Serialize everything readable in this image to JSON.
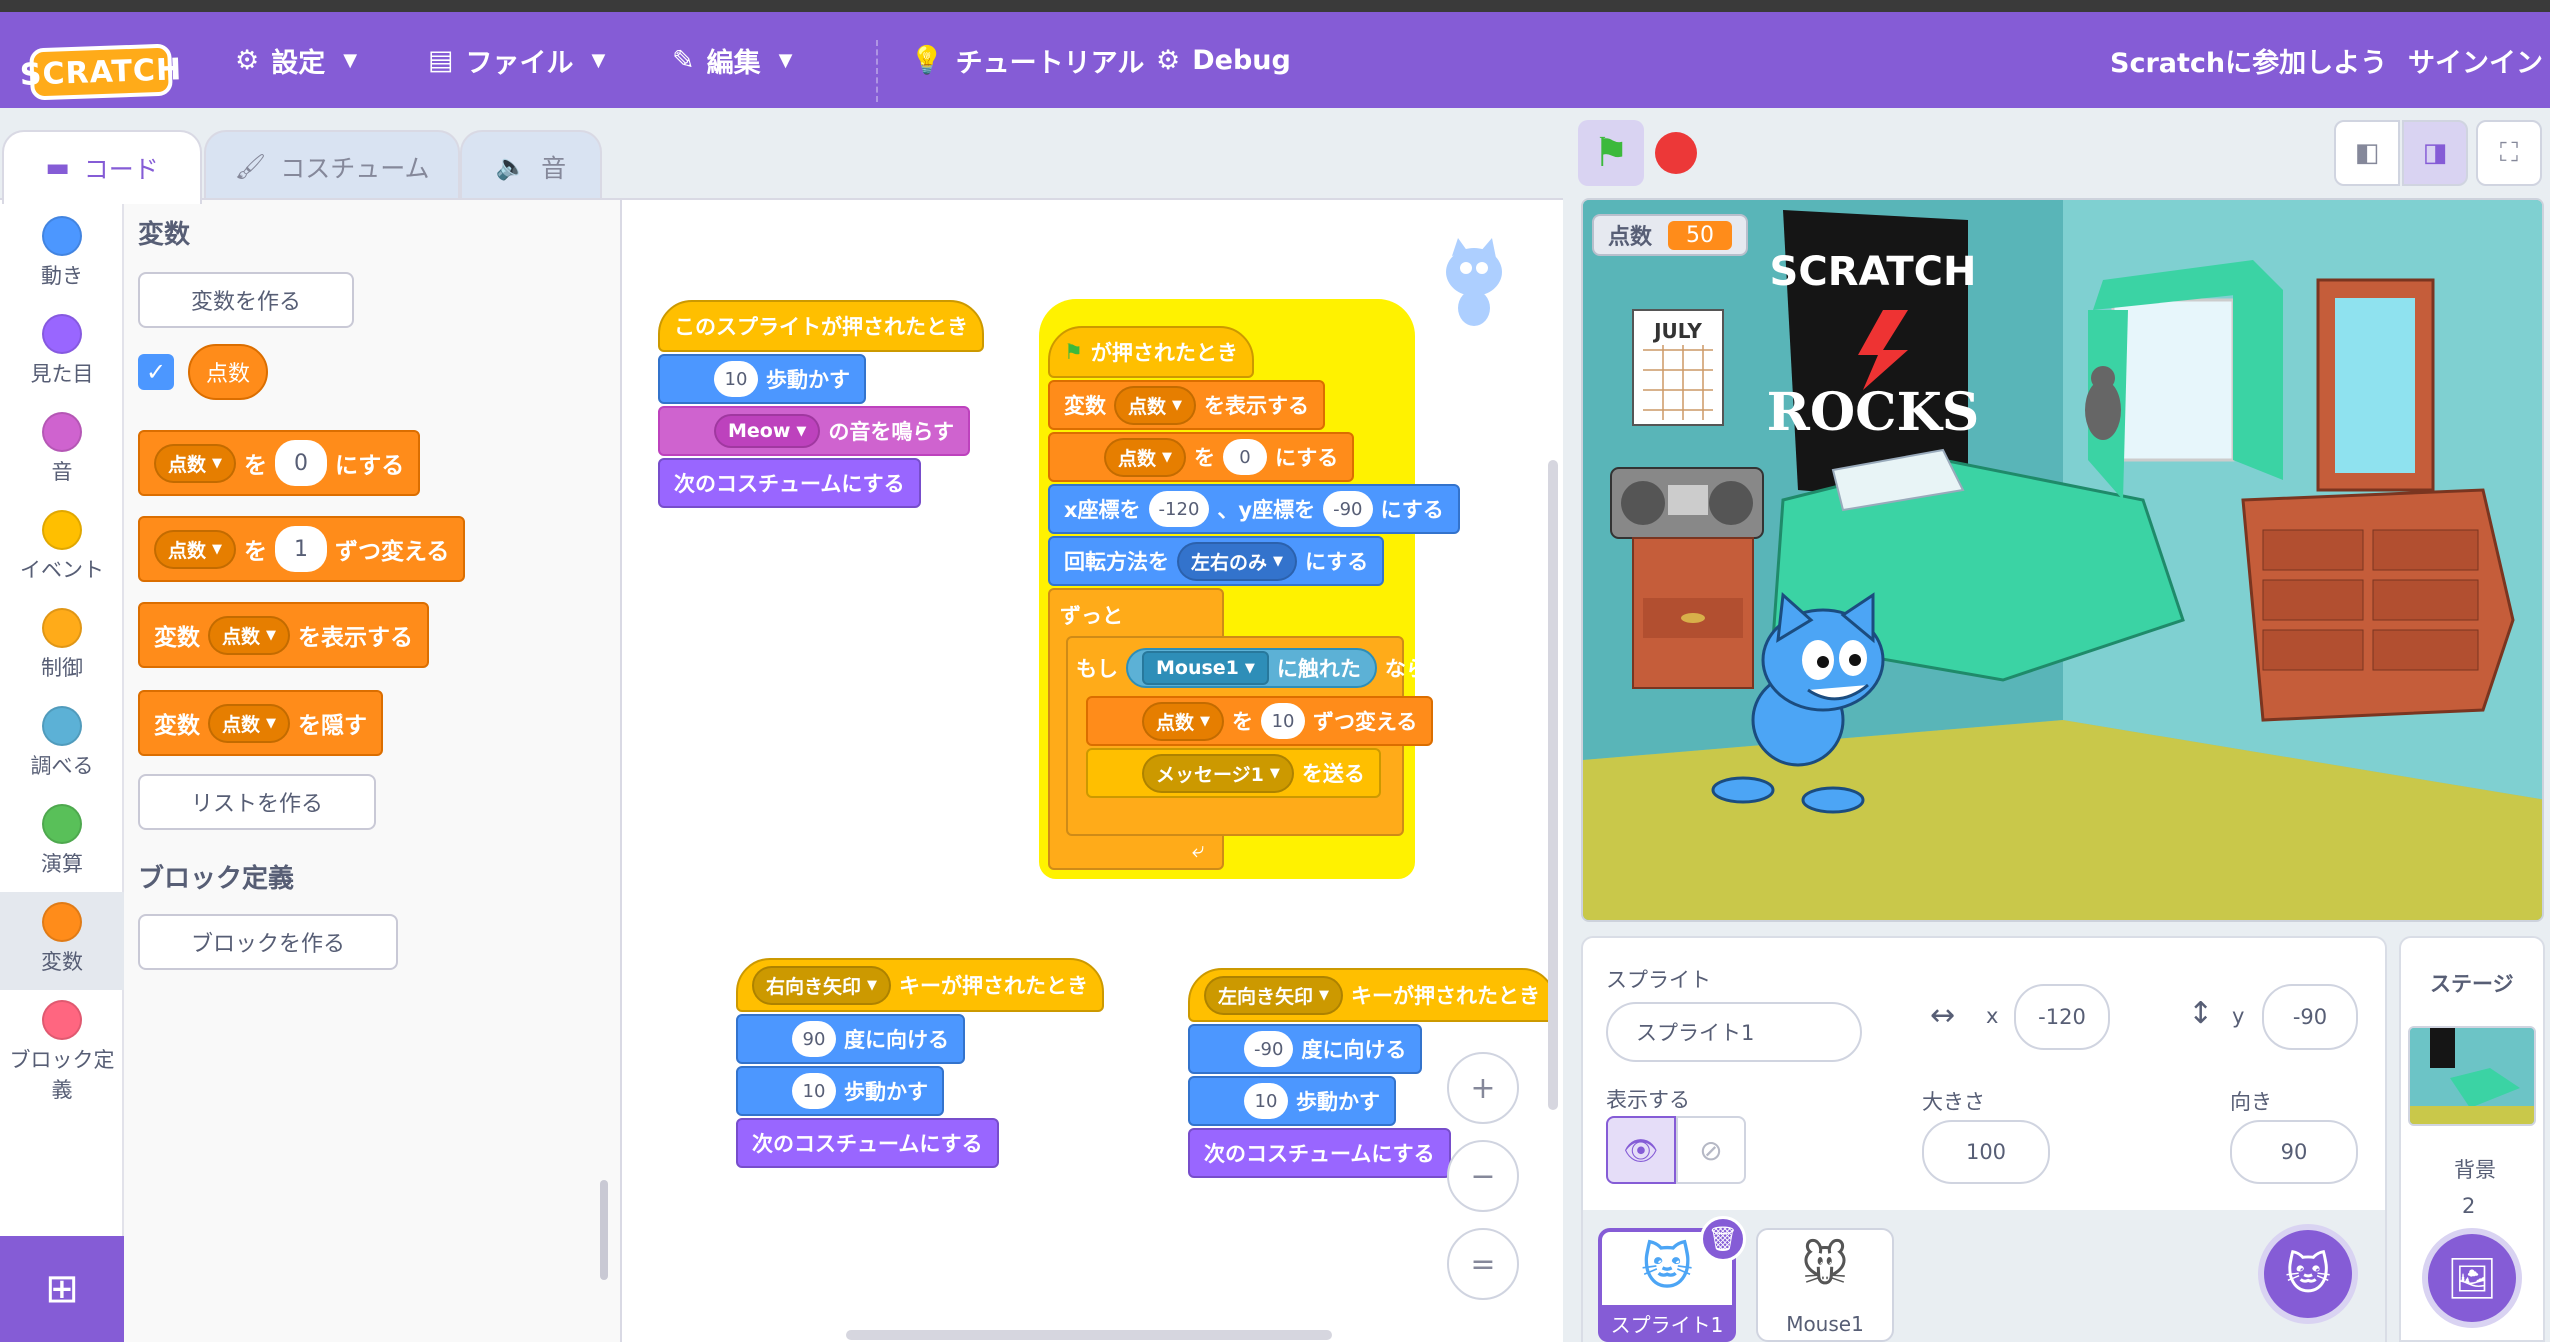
{
  "menubar": {
    "logo": "SCRATCH",
    "settings": "設定",
    "file": "ファイル",
    "edit": "編集",
    "tutorials": "チュートリアル",
    "debug": "Debug",
    "join": "Scratchに参加しよう",
    "signin": "サインイン"
  },
  "tabs": {
    "code": "コード",
    "costumes": "コスチューム",
    "sounds": "音"
  },
  "categories": [
    {
      "label": "動き",
      "color": "#4c97ff"
    },
    {
      "label": "見た目",
      "color": "#9966ff"
    },
    {
      "label": "音",
      "color": "#cf63cf"
    },
    {
      "label": "イベント",
      "color": "#ffbf00"
    },
    {
      "label": "制御",
      "color": "#ffab19"
    },
    {
      "label": "調べる",
      "color": "#5cb1d6"
    },
    {
      "label": "演算",
      "color": "#59c059"
    },
    {
      "label": "変数",
      "color": "#ff8c1a"
    },
    {
      "label": "ブロック定義",
      "color": "#ff6680"
    }
  ],
  "palette": {
    "heading": "変数",
    "make_variable": "変数を作る",
    "variable_name": "点数",
    "set_to": [
      "を",
      "0",
      "にする"
    ],
    "change_by": [
      "を",
      "1",
      "ずつ変える"
    ],
    "show_var": [
      "変数",
      "を表示する"
    ],
    "hide_var": [
      "変数",
      "を隠す"
    ],
    "make_list": "リストを作る",
    "myblocks_heading": "ブロック定義",
    "make_block": "ブロックを作る"
  },
  "scripts": {
    "s1": {
      "hat": "このスプライトが押されたとき",
      "move": "10",
      "move_lbl": "歩動かす",
      "sound": "Meow",
      "sound_lbl": "の音を鳴らす",
      "next_costume": "次のコスチュームにする"
    },
    "s2": {
      "hat": "が押されたとき",
      "show_a": "変数",
      "show_var": "点数",
      "show_b": "を表示する",
      "set_var": "点数",
      "set_a": "を",
      "set_val": "0",
      "set_b": "にする",
      "goto_a": "x座標を",
      "goto_x": "-120",
      "goto_b": "、y座標を",
      "goto_y": "-90",
      "goto_c": "にする",
      "rot_a": "回転方法を",
      "rot_val": "左右のみ",
      "rot_b": "にする",
      "forever": "ずっと",
      "if_a": "もし",
      "touch": "Mouse1",
      "touch_b": "に触れた",
      "if_b": "なら",
      "chg_var": "点数",
      "chg_a": "を",
      "chg_val": "10",
      "chg_b": "ずつ変える",
      "bcast": "メッセージ1",
      "bcast_b": "を送る",
      "loop_arrow": "⤶"
    },
    "s3": {
      "key": "右向き矢印",
      "hat_b": "キーが押されたとき",
      "dir": "90",
      "dir_lbl": "度に向ける",
      "move": "10",
      "move_lbl": "歩動かす",
      "next_costume": "次のコスチュームにする"
    },
    "s4": {
      "key": "左向き矢印",
      "hat_b": "キーが押されたとき",
      "dir": "-90",
      "dir_lbl": "度に向ける",
      "move": "10",
      "move_lbl": "歩動かす",
      "next_costume": "次のコスチュームにする"
    }
  },
  "zoom": {
    "in": "+",
    "out": "−",
    "reset": "="
  },
  "stage": {
    "monitor_label": "点数",
    "monitor_value": "50",
    "poster_line1": "SCRATCH",
    "poster_line2": "ROCKS",
    "calendar": "JULY"
  },
  "sprite_info": {
    "sprite_label": "スプライト",
    "sprite_name": "スプライト1",
    "x_label": "x",
    "x": "-120",
    "y_label": "y",
    "y": "-90",
    "show_label": "表示する",
    "size_label": "大きさ",
    "size": "100",
    "direction_label": "向き",
    "direction": "90"
  },
  "sprites": [
    {
      "name": "スプライト1",
      "selected": true
    },
    {
      "name": "Mouse1",
      "selected": false
    }
  ],
  "stage_panel": {
    "title": "ステージ",
    "backdrops_label": "背景",
    "backdrops_count": "2"
  }
}
